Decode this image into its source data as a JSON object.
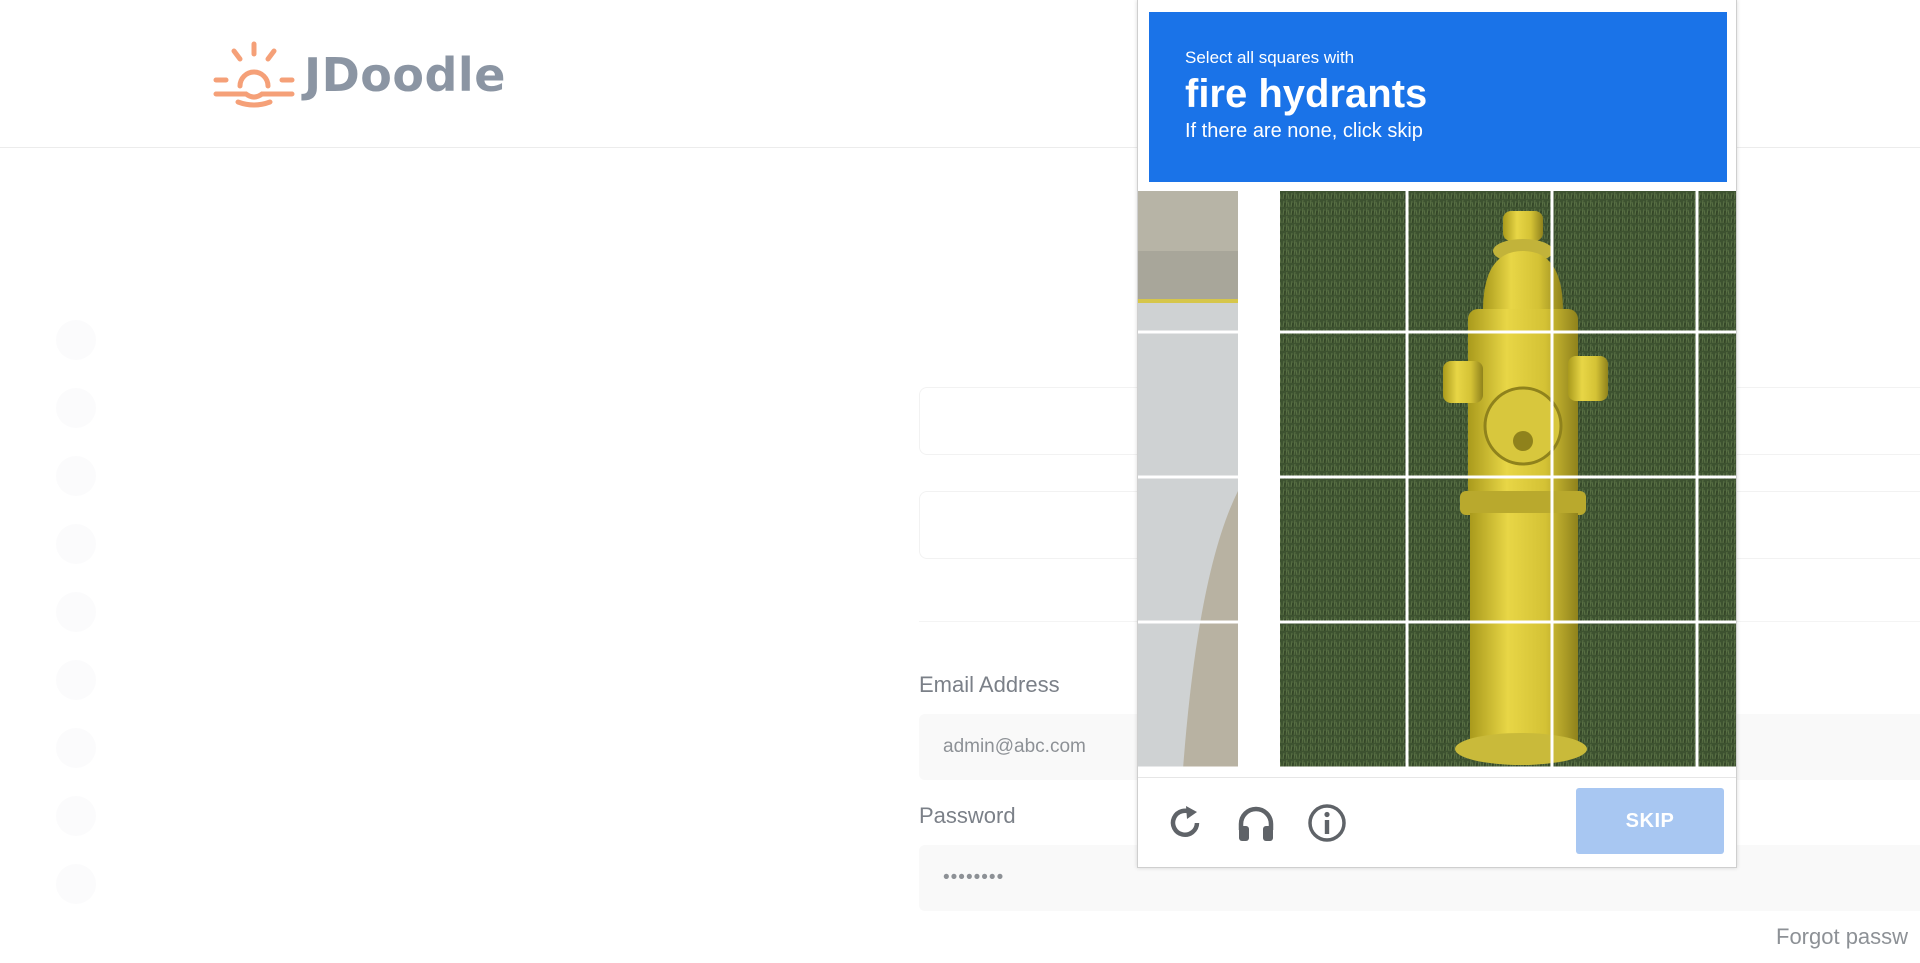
{
  "header": {
    "brand_name": "JDoodle"
  },
  "login_form": {
    "email_label": "Email Address",
    "email_value": "admin@abc.com",
    "password_label": "Password",
    "password_value": "••••••••",
    "forgot_link": "Forgot passw"
  },
  "captcha": {
    "instruction_small": "Select all squares with",
    "instruction_target": "fire hydrants",
    "instruction_sub": "If there are none, click skip",
    "grid": {
      "rows": 4,
      "cols": 4
    },
    "footer": {
      "reload_icon": "reload-icon",
      "audio_icon": "headphones-icon",
      "info_icon": "info-icon",
      "skip_label": "SKIP"
    },
    "colors": {
      "header_bg": "#1a73e8",
      "skip_bg": "#a8c7f2"
    }
  },
  "colors": {
    "logo_orange": "#f5a078",
    "logo_text": "#8b95a3"
  }
}
